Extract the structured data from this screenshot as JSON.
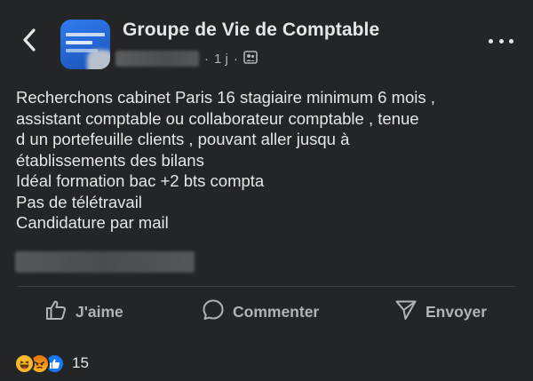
{
  "header": {
    "back_icon": "chevron-left-icon",
    "group_name": "Groupe de Vie de Comptable",
    "time_ago": "1 j",
    "separator": "·",
    "audience_icon": "group-members-icon",
    "more_icon": "more-horizontal-icon"
  },
  "post": {
    "lines": [
      "Recherchons cabinet Paris 16 stagiaire minimum 6 mois ,",
      "assistant comptable ou collaborateur comptable , tenue",
      "d un portefeuille clients , pouvant aller jusqu à",
      "établissements des bilans",
      "Idéal formation bac +2 bts  compta",
      "Pas de télétravail",
      "Candidature par mail"
    ]
  },
  "actions": {
    "like_label": "J'aime",
    "comment_label": "Commenter",
    "share_label": "Envoyer"
  },
  "reactions": {
    "types": [
      "haha",
      "angry",
      "like"
    ],
    "count": "15"
  },
  "colors": {
    "background": "#242526",
    "text_primary": "#e4e6eb",
    "text_secondary": "#b0b3b8",
    "like_blue": "#1877f2",
    "haha_yellow": "#f7b928"
  }
}
